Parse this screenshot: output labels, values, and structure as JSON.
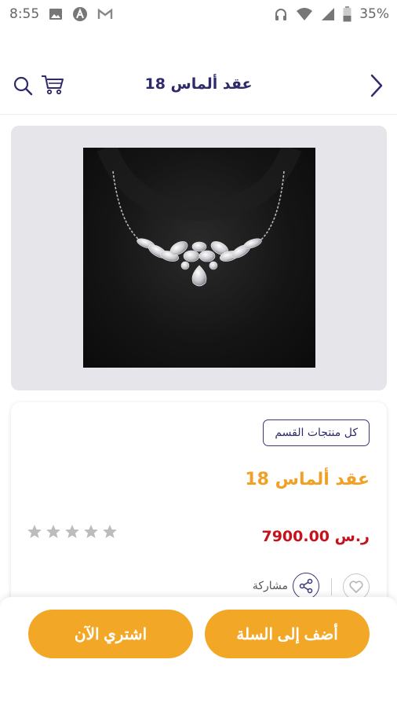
{
  "status_bar": {
    "time": "8:55",
    "battery": "35%",
    "left_icons": [
      "image-icon",
      "a-badge-icon",
      "gmail-icon"
    ],
    "right_icons": [
      "headphones-icon",
      "wifi-icon",
      "signal-icon",
      "battery-icon"
    ]
  },
  "header": {
    "title": "عقد ألماس 18",
    "icons": [
      "search-icon",
      "cart-icon",
      "chevron-right-icon"
    ]
  },
  "product": {
    "category_button": "كل منتجات القسم",
    "name": "عقد ألماس 18",
    "price": "7900.00 ر.س",
    "rating": 0,
    "rating_max": 5,
    "share_label": "مشاركة"
  },
  "actions": {
    "add_to_cart": "أضف إلى السلة",
    "buy_now": "اشتري الآن"
  },
  "colors": {
    "primary": "#2e2a6b",
    "accent": "#f2a826",
    "price": "#c5121c"
  }
}
